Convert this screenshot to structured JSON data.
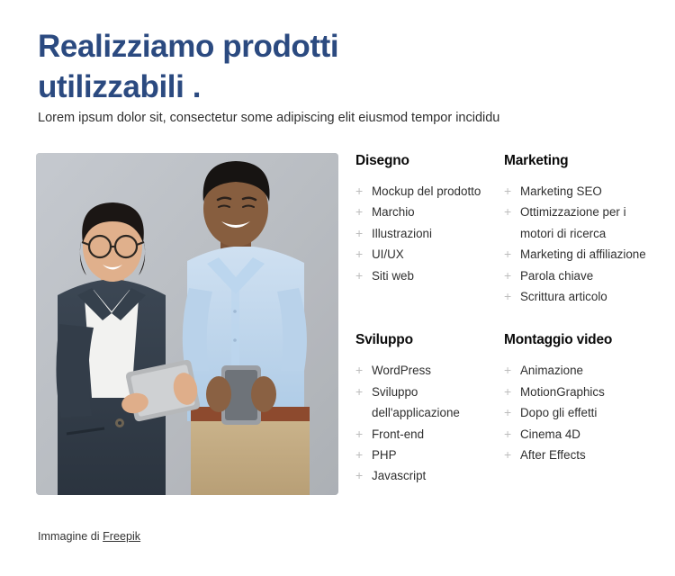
{
  "hero": {
    "heading": "Realizziamo prodotti\nutilizzabili .",
    "subtitle": "Lorem ipsum dolor sit, consectetur some adipiscing elit eiusmod tempor incididu",
    "heading_color": "#2b4a80"
  },
  "photo": {
    "alt": "Due giovani professionisti sorridenti appoggiati a un muro grigio, con tablet e smartphone",
    "background_color": "#b9bdc4"
  },
  "services": [
    {
      "title": "Disegno",
      "items": [
        "Mockup del prodotto",
        "Marchio",
        "Illustrazioni",
        "UI/UX",
        "Siti web"
      ]
    },
    {
      "title": "Marketing",
      "items": [
        "Marketing SEO",
        "Ottimizzazione per i motori di ricerca",
        "Marketing di affiliazione",
        "Parola chiave",
        "Scrittura articolo"
      ]
    },
    {
      "title": "Sviluppo",
      "items": [
        "WordPress",
        "Sviluppo dell'applicazione",
        "Front-end",
        "PHP",
        "Javascript"
      ]
    },
    {
      "title": "Montaggio video",
      "items": [
        "Animazione",
        "MotionGraphics",
        "Dopo gli effetti",
        "Cinema 4D",
        "After Effects"
      ]
    }
  ],
  "icons": {
    "bullet": "+"
  },
  "credit": {
    "prefix": "Immagine di ",
    "link_label": "Freepik"
  }
}
